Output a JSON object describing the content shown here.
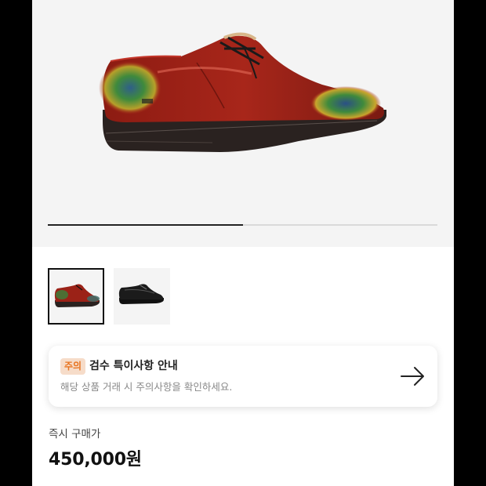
{
  "gallery": {
    "current_index": 1,
    "total_images": 2,
    "progress_fraction": 0.5,
    "thumbnails": [
      {
        "alt": "red-green-derby-shoe",
        "selected": true
      },
      {
        "alt": "black-derby-shoe",
        "selected": false
      }
    ]
  },
  "notice": {
    "badge": "주의",
    "title": "검수 특이사항 안내",
    "description": "해당 상품 거래 시 주의사항을 확인하세요.",
    "icon": "arrow-right-icon"
  },
  "price": {
    "label": "즉시 구매가",
    "value": "450,000원"
  },
  "colors": {
    "accent_orange": "#e8731f",
    "badge_bg": "#f6dcc9",
    "text_primary": "#111111",
    "text_secondary": "#888888"
  }
}
